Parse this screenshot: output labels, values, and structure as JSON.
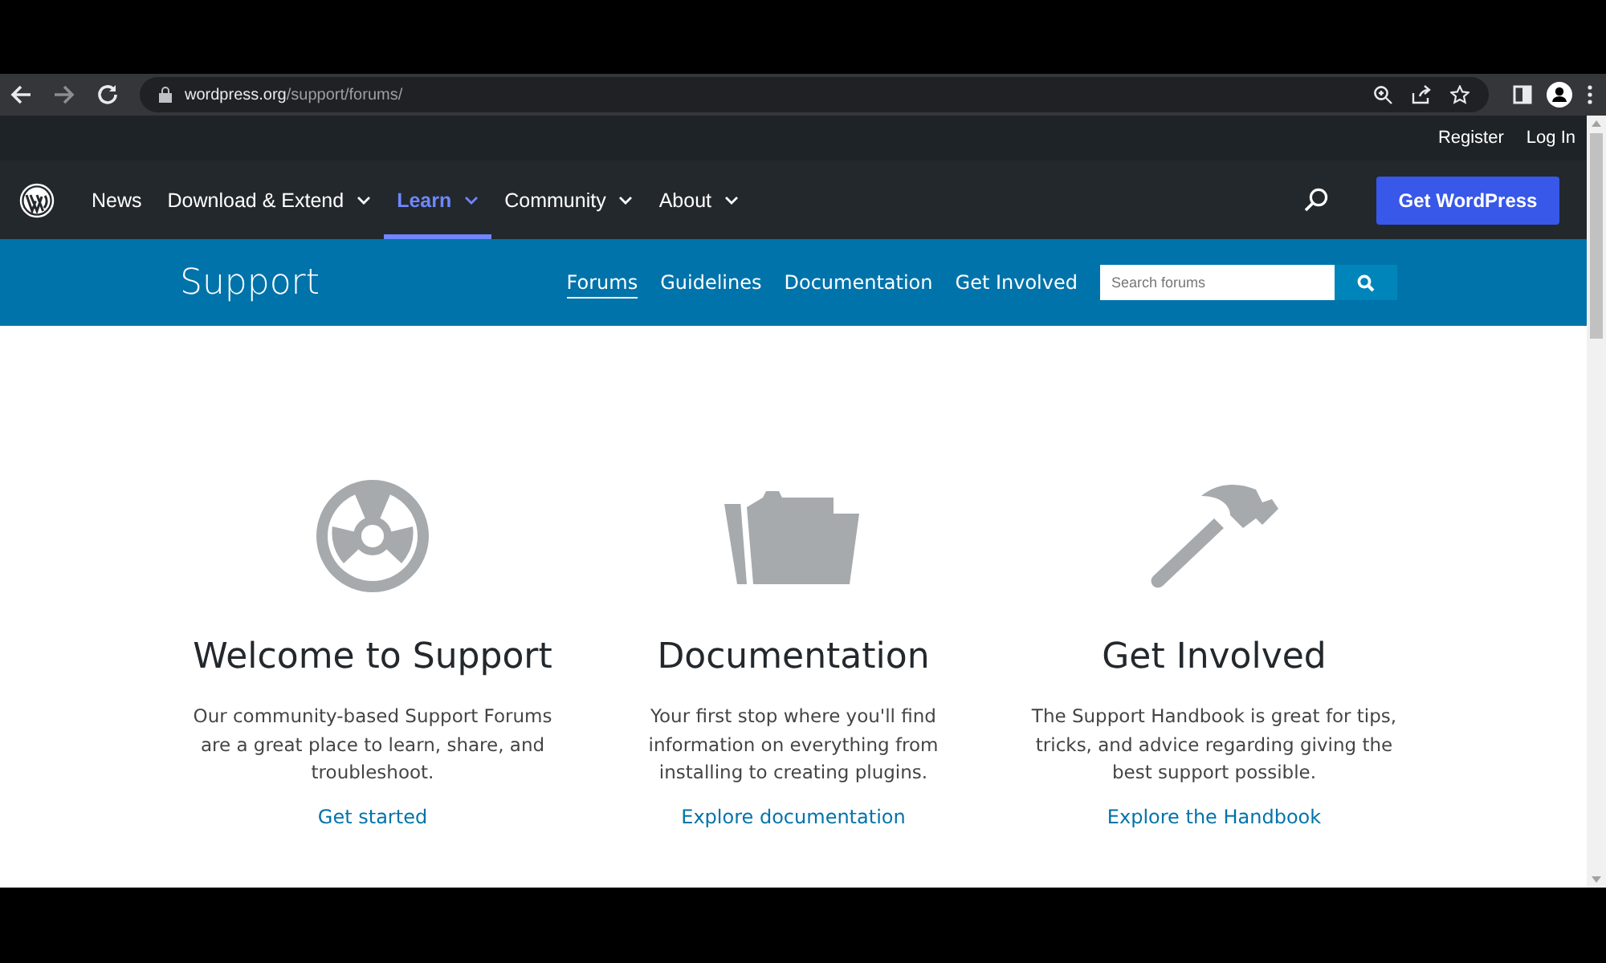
{
  "browser": {
    "url_host": "wordpress.org",
    "url_path": "/support/forums/"
  },
  "top_bar": {
    "links": [
      "Register",
      "Log In"
    ]
  },
  "nav": {
    "items": [
      {
        "label": "News",
        "dropdown": false,
        "selected": false
      },
      {
        "label": "Download & Extend",
        "dropdown": true,
        "selected": false
      },
      {
        "label": "Learn",
        "dropdown": true,
        "selected": true
      },
      {
        "label": "Community",
        "dropdown": true,
        "selected": false
      },
      {
        "label": "About",
        "dropdown": true,
        "selected": false
      }
    ],
    "cta": "Get WordPress"
  },
  "support_bar": {
    "title": "Support",
    "links": [
      {
        "label": "Forums",
        "selected": true
      },
      {
        "label": "Guidelines",
        "selected": false
      },
      {
        "label": "Documentation",
        "selected": false
      },
      {
        "label": "Get Involved",
        "selected": false
      }
    ],
    "search": {
      "placeholder": "Search forums"
    }
  },
  "cards": [
    {
      "kind": "lifebuoy",
      "title": "Welcome to Support",
      "text": "Our community-based Support Forums are a great place to learn, share, and troubleshoot.",
      "link": "Get started"
    },
    {
      "kind": "folder",
      "title": "Documentation",
      "text": "Your first stop where you'll find information on everything from installing to creating plugins.",
      "link": "Explore documentation"
    },
    {
      "kind": "hammer",
      "title": "Get Involved",
      "text": "The Support Handbook is great for tips, tricks, and advice regarding giving the best support possible.",
      "link": "Explore the Handbook"
    }
  ]
}
